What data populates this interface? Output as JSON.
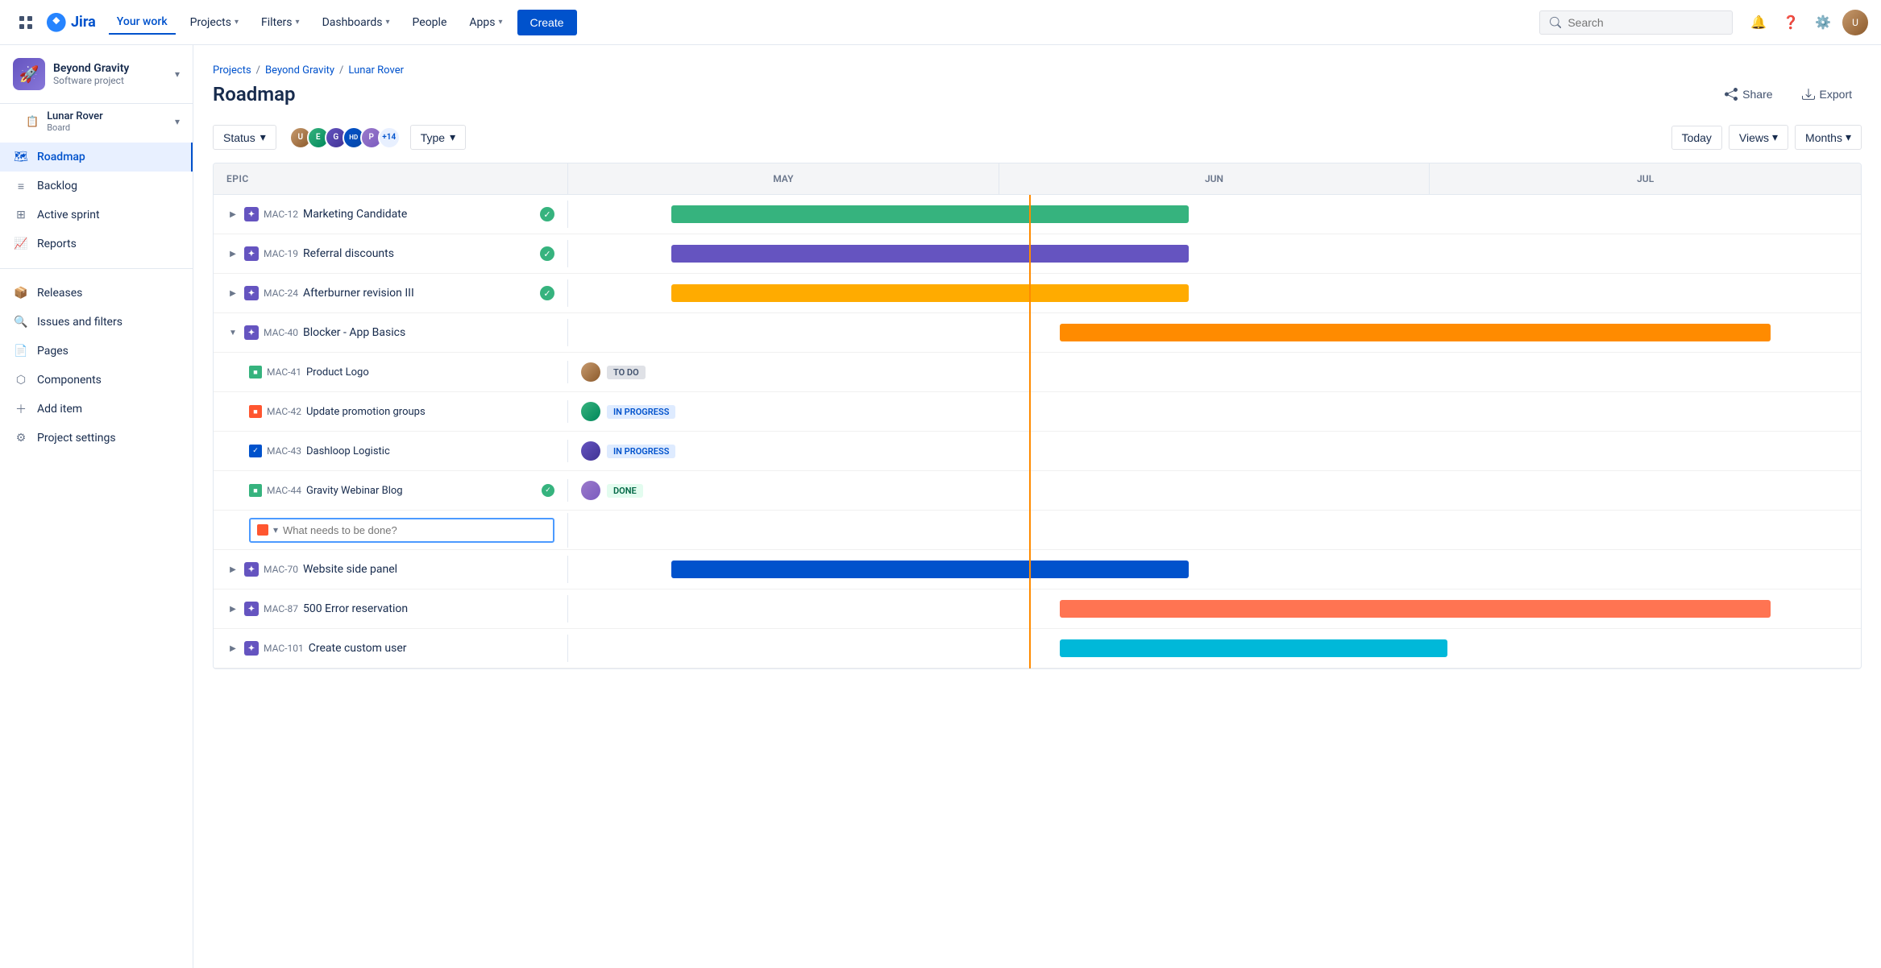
{
  "nav": {
    "logo_text": "Jira",
    "links": [
      {
        "label": "Your work",
        "active": true
      },
      {
        "label": "Projects",
        "has_dropdown": true
      },
      {
        "label": "Filters",
        "has_dropdown": true
      },
      {
        "label": "Dashboards",
        "has_dropdown": true
      },
      {
        "label": "People",
        "has_dropdown": false
      },
      {
        "label": "Apps",
        "has_dropdown": true
      }
    ],
    "create_label": "Create",
    "search_placeholder": "Search"
  },
  "sidebar": {
    "project_name": "Beyond Gravity",
    "project_type": "Software project",
    "board_name": "Lunar Rover",
    "board_sub": "Board",
    "items": [
      {
        "label": "Roadmap",
        "active": true,
        "icon": "map"
      },
      {
        "label": "Backlog",
        "icon": "list"
      },
      {
        "label": "Active sprint",
        "icon": "grid"
      },
      {
        "label": "Reports",
        "icon": "chart"
      }
    ],
    "bottom_items": [
      {
        "label": "Releases",
        "icon": "box"
      },
      {
        "label": "Issues and filters",
        "icon": "filter"
      },
      {
        "label": "Pages",
        "icon": "file"
      },
      {
        "label": "Components",
        "icon": "component"
      },
      {
        "label": "Add item",
        "icon": "plus"
      },
      {
        "label": "Project settings",
        "icon": "settings"
      }
    ]
  },
  "breadcrumb": {
    "parts": [
      "Projects",
      "Beyond Gravity",
      "Lunar Rover"
    ],
    "current": "Roadmap"
  },
  "page": {
    "title": "Roadmap",
    "share_label": "Share",
    "export_label": "Export"
  },
  "toolbar": {
    "status_label": "Status",
    "type_label": "Type",
    "today_label": "Today",
    "views_label": "Views",
    "months_label": "Months",
    "avatars_extra": "+14"
  },
  "timeline": {
    "months": [
      "MAY",
      "JUN",
      "JUL"
    ],
    "today_position_pct": 28
  },
  "epics": [
    {
      "id": "MAC-12",
      "name": "Marketing Candidate",
      "done": true,
      "expanded": false,
      "bar": {
        "color": "green",
        "start_pct": 10,
        "width_pct": 40
      },
      "underline": {
        "green_pct": 50,
        "blue_pct": 50
      }
    },
    {
      "id": "MAC-19",
      "name": "Referral discounts",
      "done": true,
      "expanded": false,
      "bar": {
        "color": "purple",
        "start_pct": 10,
        "width_pct": 40
      },
      "underline": {
        "green_pct": 50,
        "blue_pct": 50
      }
    },
    {
      "id": "MAC-24",
      "name": "Afterburner revision III",
      "done": true,
      "expanded": false,
      "bar": {
        "color": "yellow",
        "start_pct": 10,
        "width_pct": 40
      },
      "underline": {
        "green_pct": 50,
        "blue_pct": 50
      }
    },
    {
      "id": "MAC-40",
      "name": "Blocker - App Basics",
      "done": false,
      "expanded": true,
      "bar": {
        "color": "orange",
        "start_pct": 38,
        "width_pct": 55
      },
      "children": [
        {
          "id": "MAC-41",
          "name": "Product Logo",
          "type": "green",
          "status": "TO DO",
          "status_type": "todo"
        },
        {
          "id": "MAC-42",
          "name": "Update promotion groups",
          "type": "red",
          "status": "IN PROGRESS",
          "status_type": "in-progress"
        },
        {
          "id": "MAC-43",
          "name": "Dashloop Logistic",
          "type": "blue",
          "status": "IN PROGRESS",
          "status_type": "in-progress"
        },
        {
          "id": "MAC-44",
          "name": "Gravity Webinar Blog",
          "type": "green",
          "done": true,
          "status": "DONE",
          "status_type": "done"
        }
      ]
    },
    {
      "id": "MAC-70",
      "name": "Website side panel",
      "done": false,
      "expanded": false,
      "bar": {
        "color": "blue",
        "start_pct": 10,
        "width_pct": 40
      },
      "underline": {
        "green_pct": 50,
        "blue_pct": 50
      }
    },
    {
      "id": "MAC-87",
      "name": "500 Error reservation",
      "done": false,
      "expanded": false,
      "bar": {
        "color": "coral",
        "start_pct": 38,
        "width_pct": 55
      },
      "underline": {
        "green_pct": 50,
        "blue_pct": 50
      }
    },
    {
      "id": "MAC-101",
      "name": "Create custom user",
      "done": false,
      "expanded": false,
      "bar": {
        "color": "teal",
        "start_pct": 38,
        "width_pct": 35
      },
      "underline": {
        "green_pct": 50,
        "blue_pct": 50
      }
    }
  ],
  "add_item_placeholder": "What needs to be done?"
}
